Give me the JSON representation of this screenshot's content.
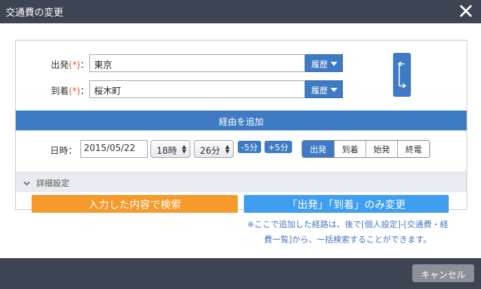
{
  "dialog": {
    "title": "交通費の変更",
    "close_icon": "close-icon"
  },
  "route": {
    "from_label": "出発",
    "to_label": "到着",
    "required_mark": "(*)",
    "colon": "：",
    "from_value": "東京",
    "to_value": "桜木町",
    "history_label": "履歴",
    "swap_icon": "swap-arrows-icon",
    "via_label": "経由を追加"
  },
  "datetime": {
    "label": "日時：",
    "date": "2015/05/22",
    "hour": "18時",
    "minute": "26分",
    "minus5": "-5分",
    "plus5": "+5分",
    "modes": [
      "出発",
      "到着",
      "始発",
      "終電"
    ],
    "active_mode": "出発"
  },
  "details": {
    "label": "詳細設定"
  },
  "actions": {
    "search": "入力した内容で検索",
    "change_only": "「出発」「到着」のみ変更",
    "note": "※ここで追加した経路は、後で[個人設定]-[交通費・経費一覧]から、一括検索することができます。"
  },
  "footer": {
    "cancel": "キャンセル"
  },
  "colors": {
    "titlebar": "#3d4452",
    "primary_blue": "#3e7bc4",
    "orange": "#f59a2b",
    "light_blue": "#3f9ef0",
    "required_red": "#e8542b"
  }
}
